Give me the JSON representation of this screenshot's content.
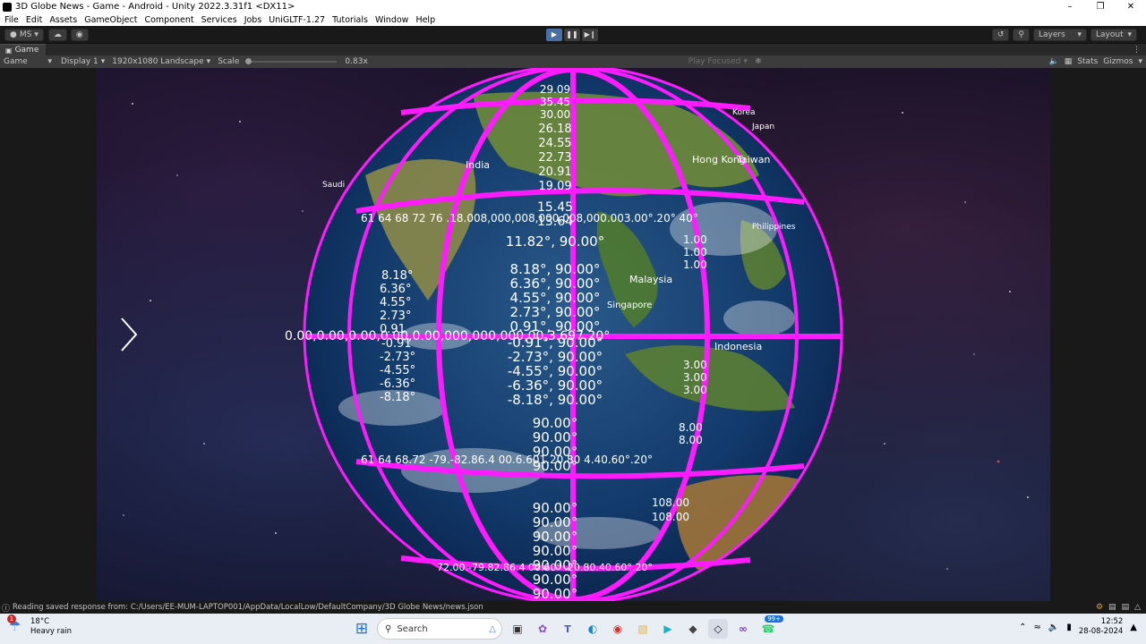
{
  "window": {
    "title": "3D Globe News - Game - Android - Unity 2022.3.31f1 <DX11>",
    "minimize": "–",
    "maximize": "❐",
    "close": "✕"
  },
  "menu": [
    "File",
    "Edit",
    "Assets",
    "GameObject",
    "Component",
    "Services",
    "Jobs",
    "UniGLTF-1.27",
    "Tutorials",
    "Window",
    "Help"
  ],
  "toolbar": {
    "account": "MS",
    "layers": "Layers",
    "layout": "Layout"
  },
  "tab": {
    "label": "Game"
  },
  "gamebar": {
    "mode": "Game",
    "display": "Display 1",
    "resolution": "1920x1080 Landscape",
    "scale_label": "Scale",
    "scale_value": "0.83x",
    "play_focused": "Play Focused",
    "stats": "Stats",
    "gizmos": "Gizmos"
  },
  "globe": {
    "country_labels": [
      "India",
      "Hong Kong",
      "Taiwan",
      "Korea",
      "Japan",
      "Malaysia",
      "Singapore",
      "Indonesia",
      "Philippines",
      "Saudi"
    ],
    "lat_labels_center": [
      "90.00°",
      "90.00°",
      "90.00°",
      "90.00°",
      "11.82°, 90.00°",
      "8.18°, 90.00°",
      "6.36°, 90.00°",
      "4.55°, 90.00°",
      "2.73°, 90.00°",
      "0.91°, 90.00°",
      "-0.91°, 90.00°",
      "-2.73°, 90.00°",
      "-4.55°, 90.00°",
      "-6.36°, 90.00°",
      "-8.18°, 90.00°",
      "90.00°",
      "90.00°",
      "90.00°",
      "90.00°",
      "90.00°",
      "90.00°",
      "90.00°"
    ],
    "top_labels": [
      "29.09",
      "35.45",
      "30.00",
      "26.18",
      "24.55",
      "22.73",
      "20.91",
      "19.09",
      "15.45",
      "13.64"
    ],
    "left_labels": [
      "8.18°",
      "6.36°",
      "4.55°",
      "2.73°",
      "0.91",
      "-0.91",
      "-2.73°",
      "-4.55°",
      "-6.36°",
      "-8.18°"
    ],
    "equator_text": "0.00,0.00,0.00,0.00,0.00,000,000,000,00,3.697.20°",
    "upper_band_text": "61 64 68 72 76 .18.008,000,008,000,008,000.003.00°.20° 40°",
    "lower_band_text": "61 64 68.72 -79.-82.86.4 00.6.601.20.80 4.40.60°.20°",
    "bottom_band_text": "72.00.-79.82.86.4 00.60° .20.80.40.60°.20°",
    "right_labels": [
      "1.00",
      "1.00",
      "1.00",
      "3.00",
      "3.00",
      "3.00",
      "8.00",
      "8.00",
      "108.00",
      "108.00"
    ]
  },
  "status": {
    "message": "Reading saved response from: C:/Users/EE-MUM-LAPTOP001/AppData/LocalLow/DefaultCompany/3D Globe News/news.json"
  },
  "taskbar": {
    "temp": "18°C",
    "weather": "Heavy rain",
    "search": "Search",
    "badge": "99+",
    "time": "12:52",
    "date": "28-08-2024",
    "weather_badge": "1"
  },
  "colors": {
    "grid": "#ff1aff",
    "label": "#ffffff",
    "ocean": "#123a6b"
  }
}
